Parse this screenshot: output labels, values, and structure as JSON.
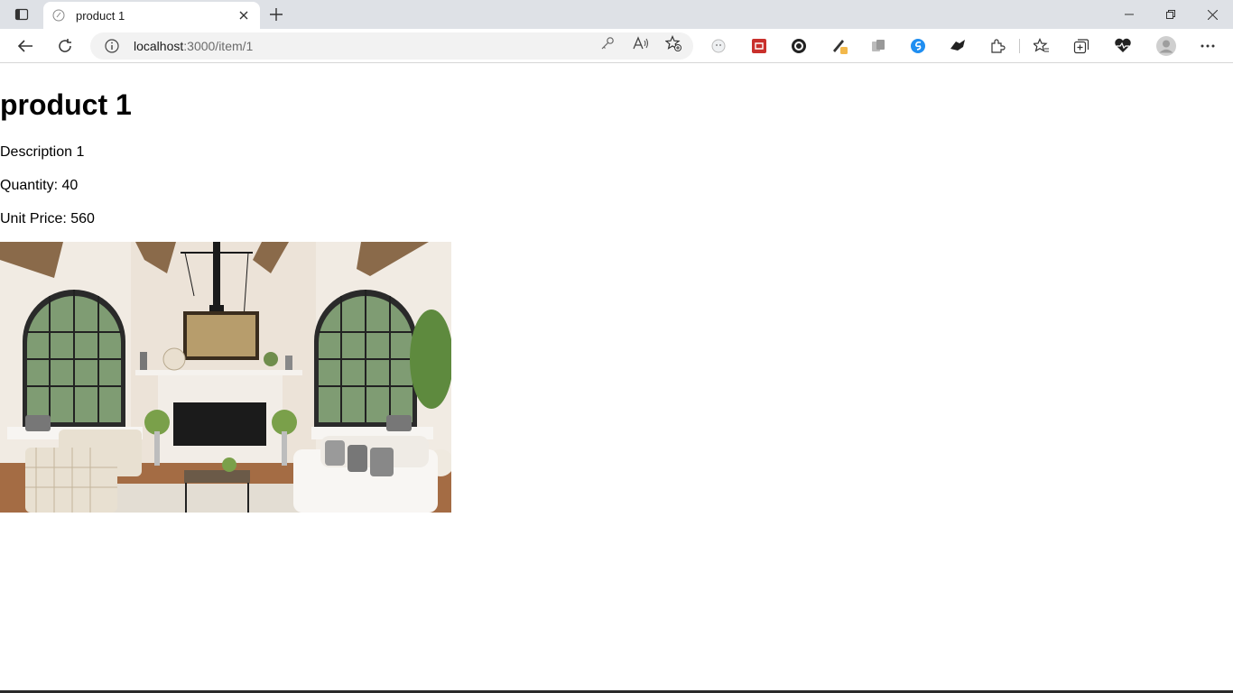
{
  "browser": {
    "tab_title": "product 1",
    "url_host": "localhost",
    "url_path": ":3000/item/1",
    "icons": {
      "tab_actions": "tab-actions-icon",
      "favicon": "page-favicon-icon",
      "close": "close-icon",
      "new_tab": "plus-icon",
      "back": "back-arrow-icon",
      "refresh": "refresh-icon",
      "info": "info-icon",
      "key": "key-icon",
      "read_aloud": "read-aloud-icon",
      "favorite_add": "star-add-icon",
      "favorites": "favorites-icon",
      "collections": "collections-icon",
      "performance": "heartbeat-icon",
      "profile": "avatar-icon",
      "more": "more-icon"
    },
    "accent_color": "#0078d4"
  },
  "product": {
    "title": "product 1",
    "description": "Description 1",
    "quantity_text": "Quantity: 40",
    "price_text": "Unit Price: 560"
  }
}
